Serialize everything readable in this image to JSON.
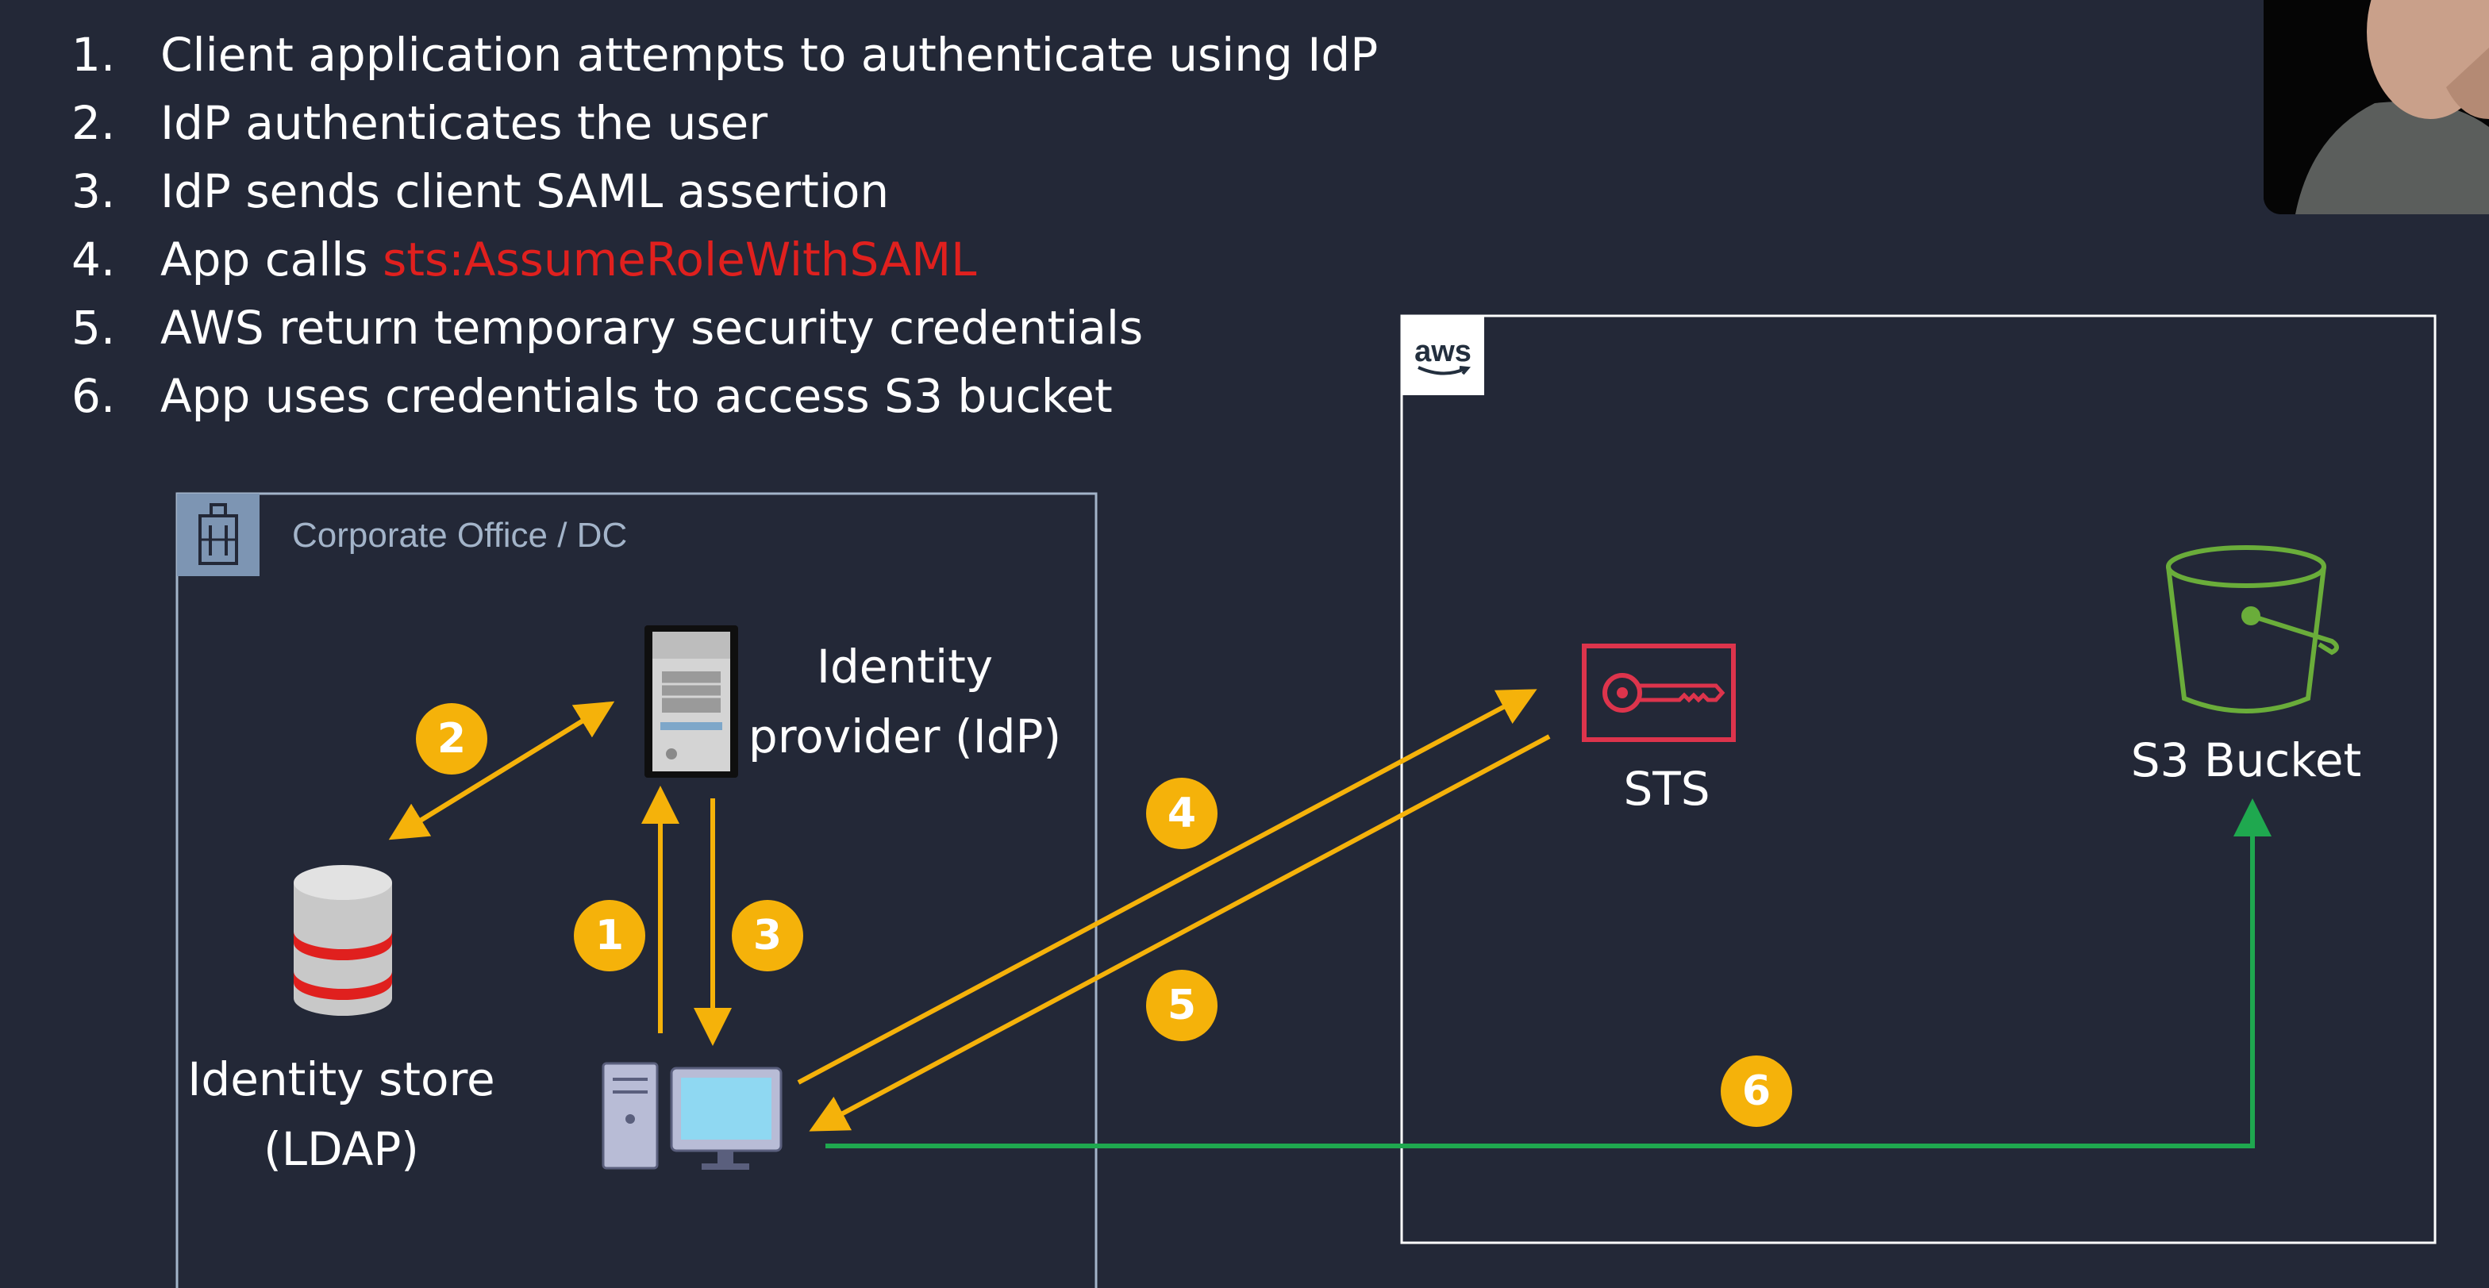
{
  "steps": [
    {
      "num": "1.",
      "text": "Client application attempts to authenticate using IdP",
      "highlight": ""
    },
    {
      "num": "2.",
      "text": "IdP authenticates the user",
      "highlight": ""
    },
    {
      "num": "3.",
      "text": "IdP sends client SAML assertion",
      "highlight": ""
    },
    {
      "num": "4.",
      "text": "App calls ",
      "highlight": "sts:AssumeRoleWithSAML"
    },
    {
      "num": "5.",
      "text": "AWS return temporary security credentials",
      "highlight": ""
    },
    {
      "num": "6.",
      "text": "App uses credentials to access S3 bucket",
      "highlight": ""
    }
  ],
  "corporate": {
    "label": "Corporate Office / DC",
    "icon": "building-icon"
  },
  "aws": {
    "logo_text": "aws",
    "icon": "aws-logo-icon"
  },
  "nodes": {
    "idp": {
      "line1": "Identity",
      "line2": "provider (IdP)",
      "icon": "server-icon"
    },
    "store": {
      "line1": "Identity store",
      "line2": "(LDAP)",
      "icon": "database-icon"
    },
    "client": {
      "icon": "client-computer-icon"
    },
    "sts": {
      "label": "STS",
      "icon": "key-icon"
    },
    "s3": {
      "label": "S3 Bucket",
      "icon": "bucket-icon"
    }
  },
  "badges": [
    "1",
    "2",
    "3",
    "4",
    "5",
    "6"
  ],
  "colors": {
    "background": "#232837",
    "arrow": "#f5b20a",
    "badge": "#f5b20a",
    "s3_access": "#1fa84f",
    "highlight": "#e0201e",
    "sts": "#dd344c",
    "s3": "#6aad3a",
    "corporate_border": "#a3b4c9"
  }
}
